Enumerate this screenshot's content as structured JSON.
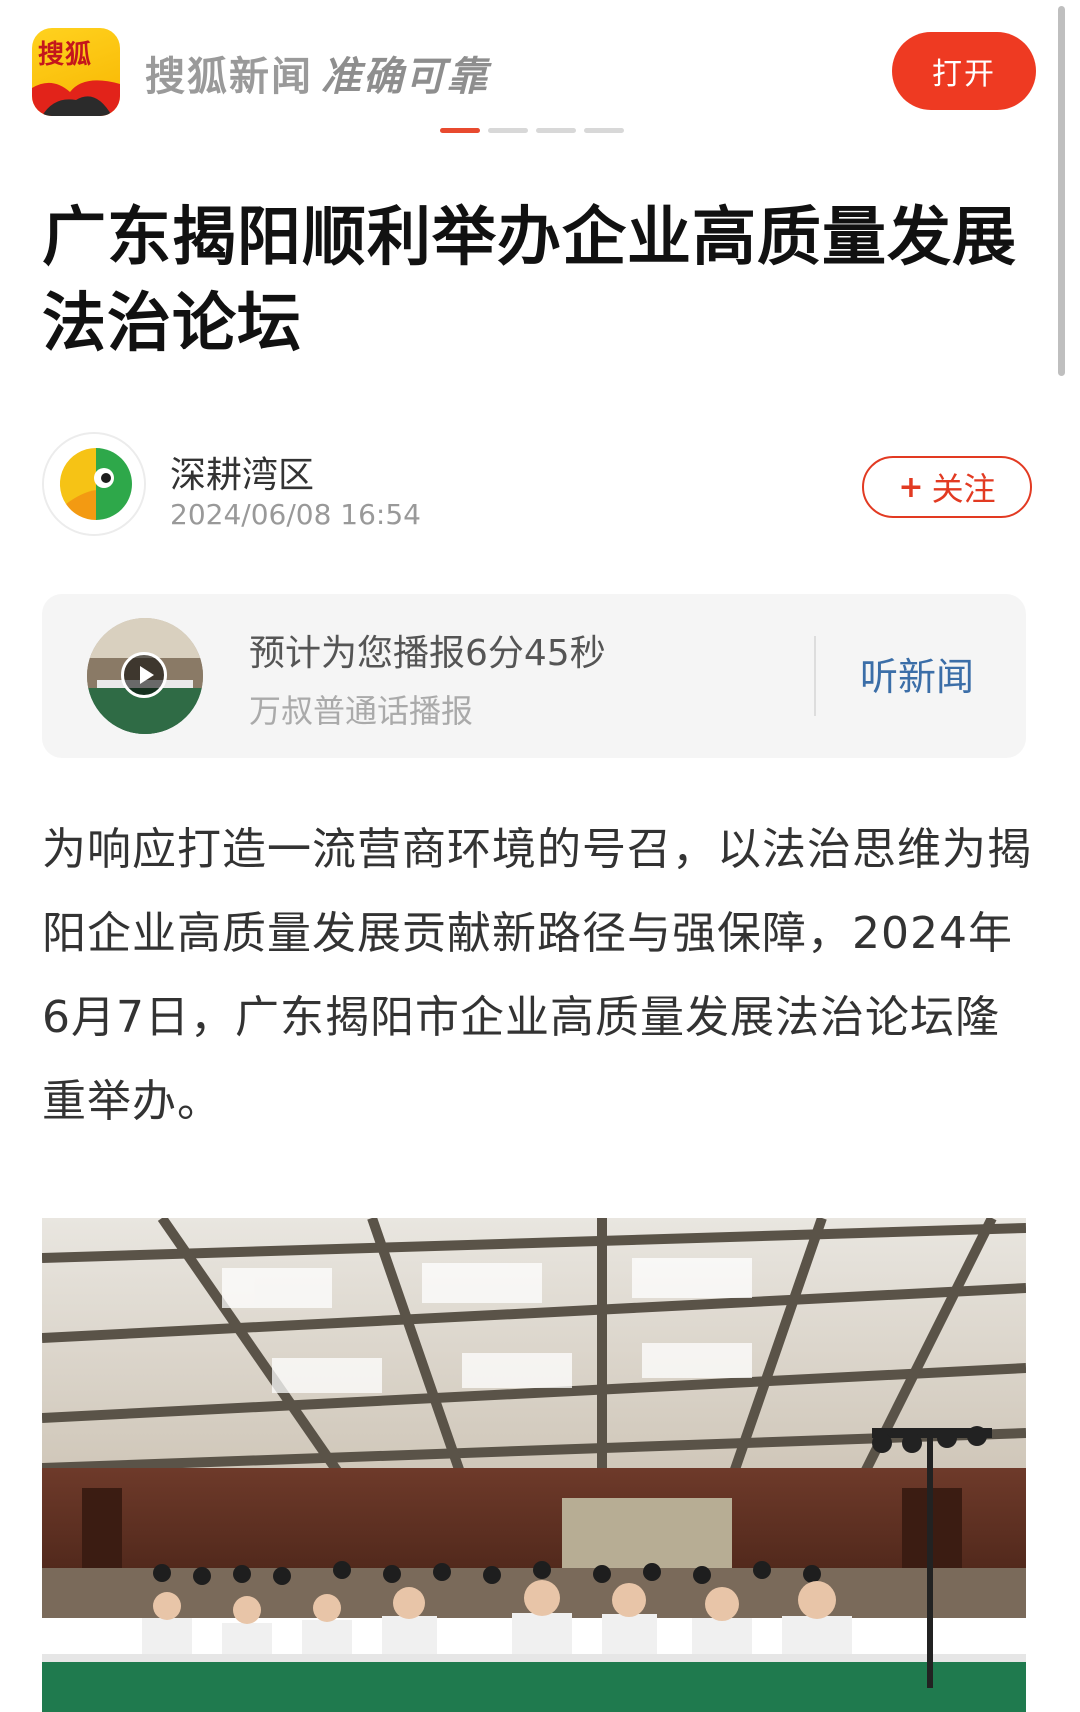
{
  "header": {
    "logo_text": "搜狐",
    "slogan_brand": "搜狐新闻",
    "slogan_tagline": "准确可靠",
    "open_button": "打开",
    "carousel": {
      "count": 4,
      "active": 0
    }
  },
  "article": {
    "title": "广东揭阳顺利举办企业高质量发展法治论坛",
    "author": {
      "name": "深耕湾区",
      "time": "2024/06/08 16:54"
    },
    "follow_button": "关注",
    "follow_icon": "plus-icon",
    "audio": {
      "primary": "预计为您播报6分45秒",
      "secondary": "万叔普通话播报",
      "listen_button": "听新闻"
    },
    "paragraph": "为响应打造一流营商环境的号召，以法治思维为揭阳企业高质量发展贡献新路径与强保障，2024年6月7日，广东揭阳市企业高质量发展法治论坛隆重举办。"
  },
  "colors": {
    "accent_red": "#ee3a22",
    "link_blue": "#3b6ea8",
    "logo_yellow": "#ffd21f"
  }
}
